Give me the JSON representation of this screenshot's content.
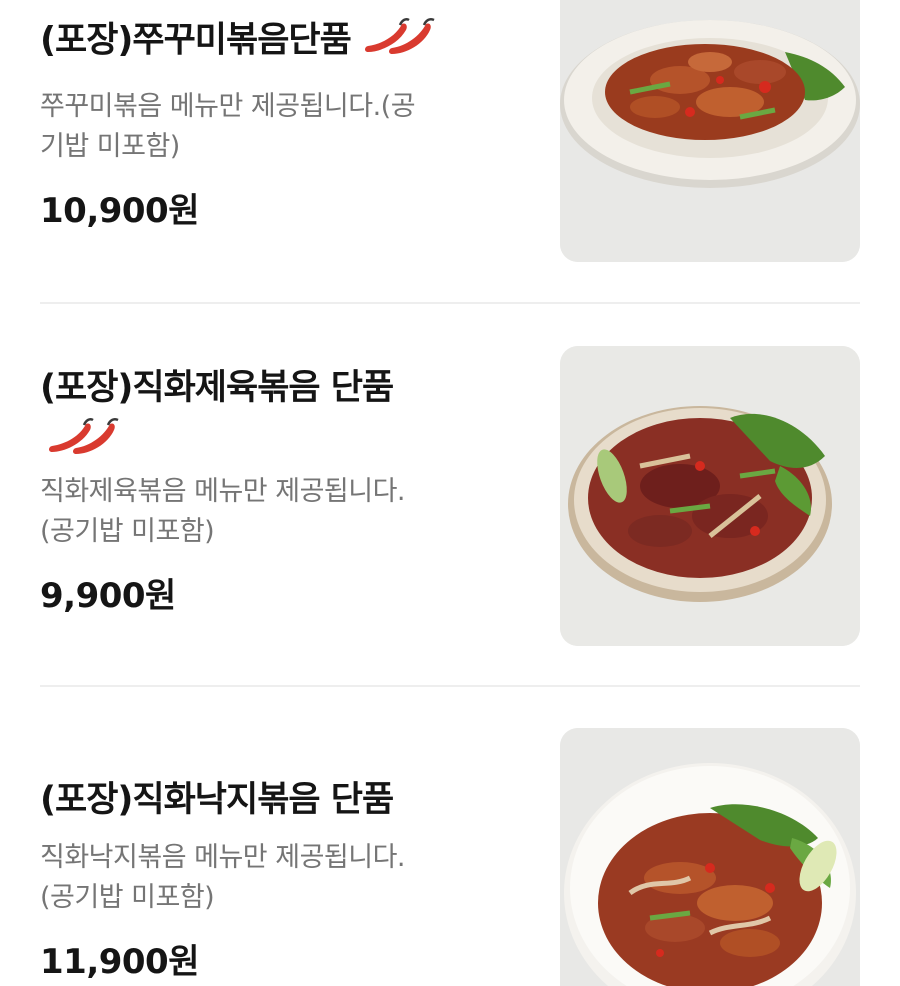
{
  "menu": {
    "items": [
      {
        "title": "(포장)쭈꾸미볶음단품",
        "spicy_icon": "chili-pepper-icon",
        "description_line1": "쭈꾸미볶음 메뉴만 제공됩니다.(공",
        "description_line2": "기밥 미포함)",
        "price": "10,900원"
      },
      {
        "title": "(포장)직화제육볶음 단품",
        "spicy_icon": "chili-pepper-icon",
        "description_line1": "직화제육볶음 메뉴만 제공됩니다.",
        "description_line2": "(공기밥 미포함)",
        "price": "9,900원"
      },
      {
        "title": "(포장)직화낙지볶음 단품",
        "description_line1": "직화낙지볶음 메뉴만 제공됩니다.",
        "description_line2": "(공기밥 미포함)",
        "price": "11,900원"
      }
    ]
  },
  "colors": {
    "title": "#151515",
    "description": "#757575",
    "price": "#151515",
    "divider": "#eeeeee",
    "pepper": "#d93a2f"
  }
}
